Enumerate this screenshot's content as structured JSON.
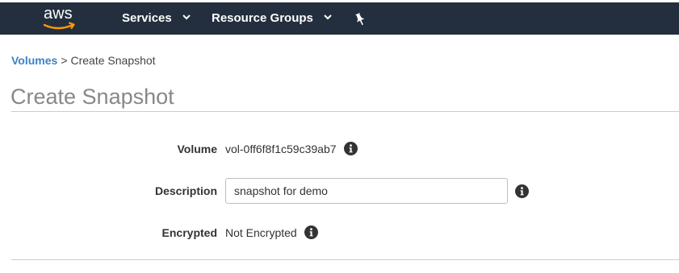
{
  "nav": {
    "logo_text": "aws",
    "services_label": "Services",
    "resource_groups_label": "Resource Groups"
  },
  "breadcrumb": {
    "parent": "Volumes",
    "separator": ">",
    "current": "Create Snapshot"
  },
  "page": {
    "title": "Create Snapshot"
  },
  "form": {
    "volume": {
      "label": "Volume",
      "value": "vol-0ff6f8f1c59c39ab7"
    },
    "description": {
      "label": "Description",
      "value": "snapshot for demo"
    },
    "encrypted": {
      "label": "Encrypted",
      "value": "Not Encrypted"
    }
  },
  "colors": {
    "nav_background": "#232f3e",
    "link": "#3b82c4",
    "logo_smile": "#ff9900"
  },
  "icons": [
    "aws-logo",
    "chevron-down-icon",
    "pin-icon",
    "info-icon"
  ]
}
